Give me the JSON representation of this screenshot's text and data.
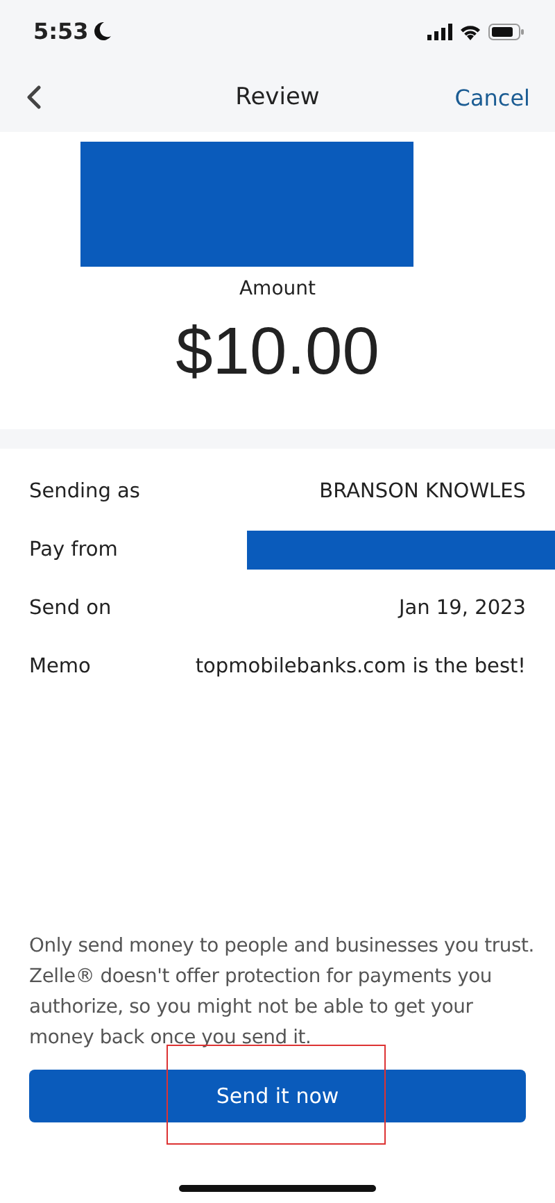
{
  "status_bar": {
    "time": "5:53"
  },
  "nav": {
    "title": "Review",
    "action": "Cancel"
  },
  "amount": {
    "redacted": true,
    "label": "Amount",
    "value": "$10.00"
  },
  "details": [
    {
      "label": "Sending as",
      "kind": "text",
      "value": "BRANSON KNOWLES"
    },
    {
      "label": "Pay from",
      "kind": "redacted"
    },
    {
      "label": "Send on",
      "kind": "text",
      "value": "Jan 19, 2023"
    },
    {
      "label": "Memo",
      "kind": "text",
      "value": "topmobilebanks.com is the best!"
    }
  ],
  "disclaimer": "Only send money to people and businesses you trust. Zelle® doesn't offer protection for payments you authorize, so you might not be able to get your money back once you send it.",
  "primary_button": {
    "label": "Send it now",
    "highlighted": true
  }
}
